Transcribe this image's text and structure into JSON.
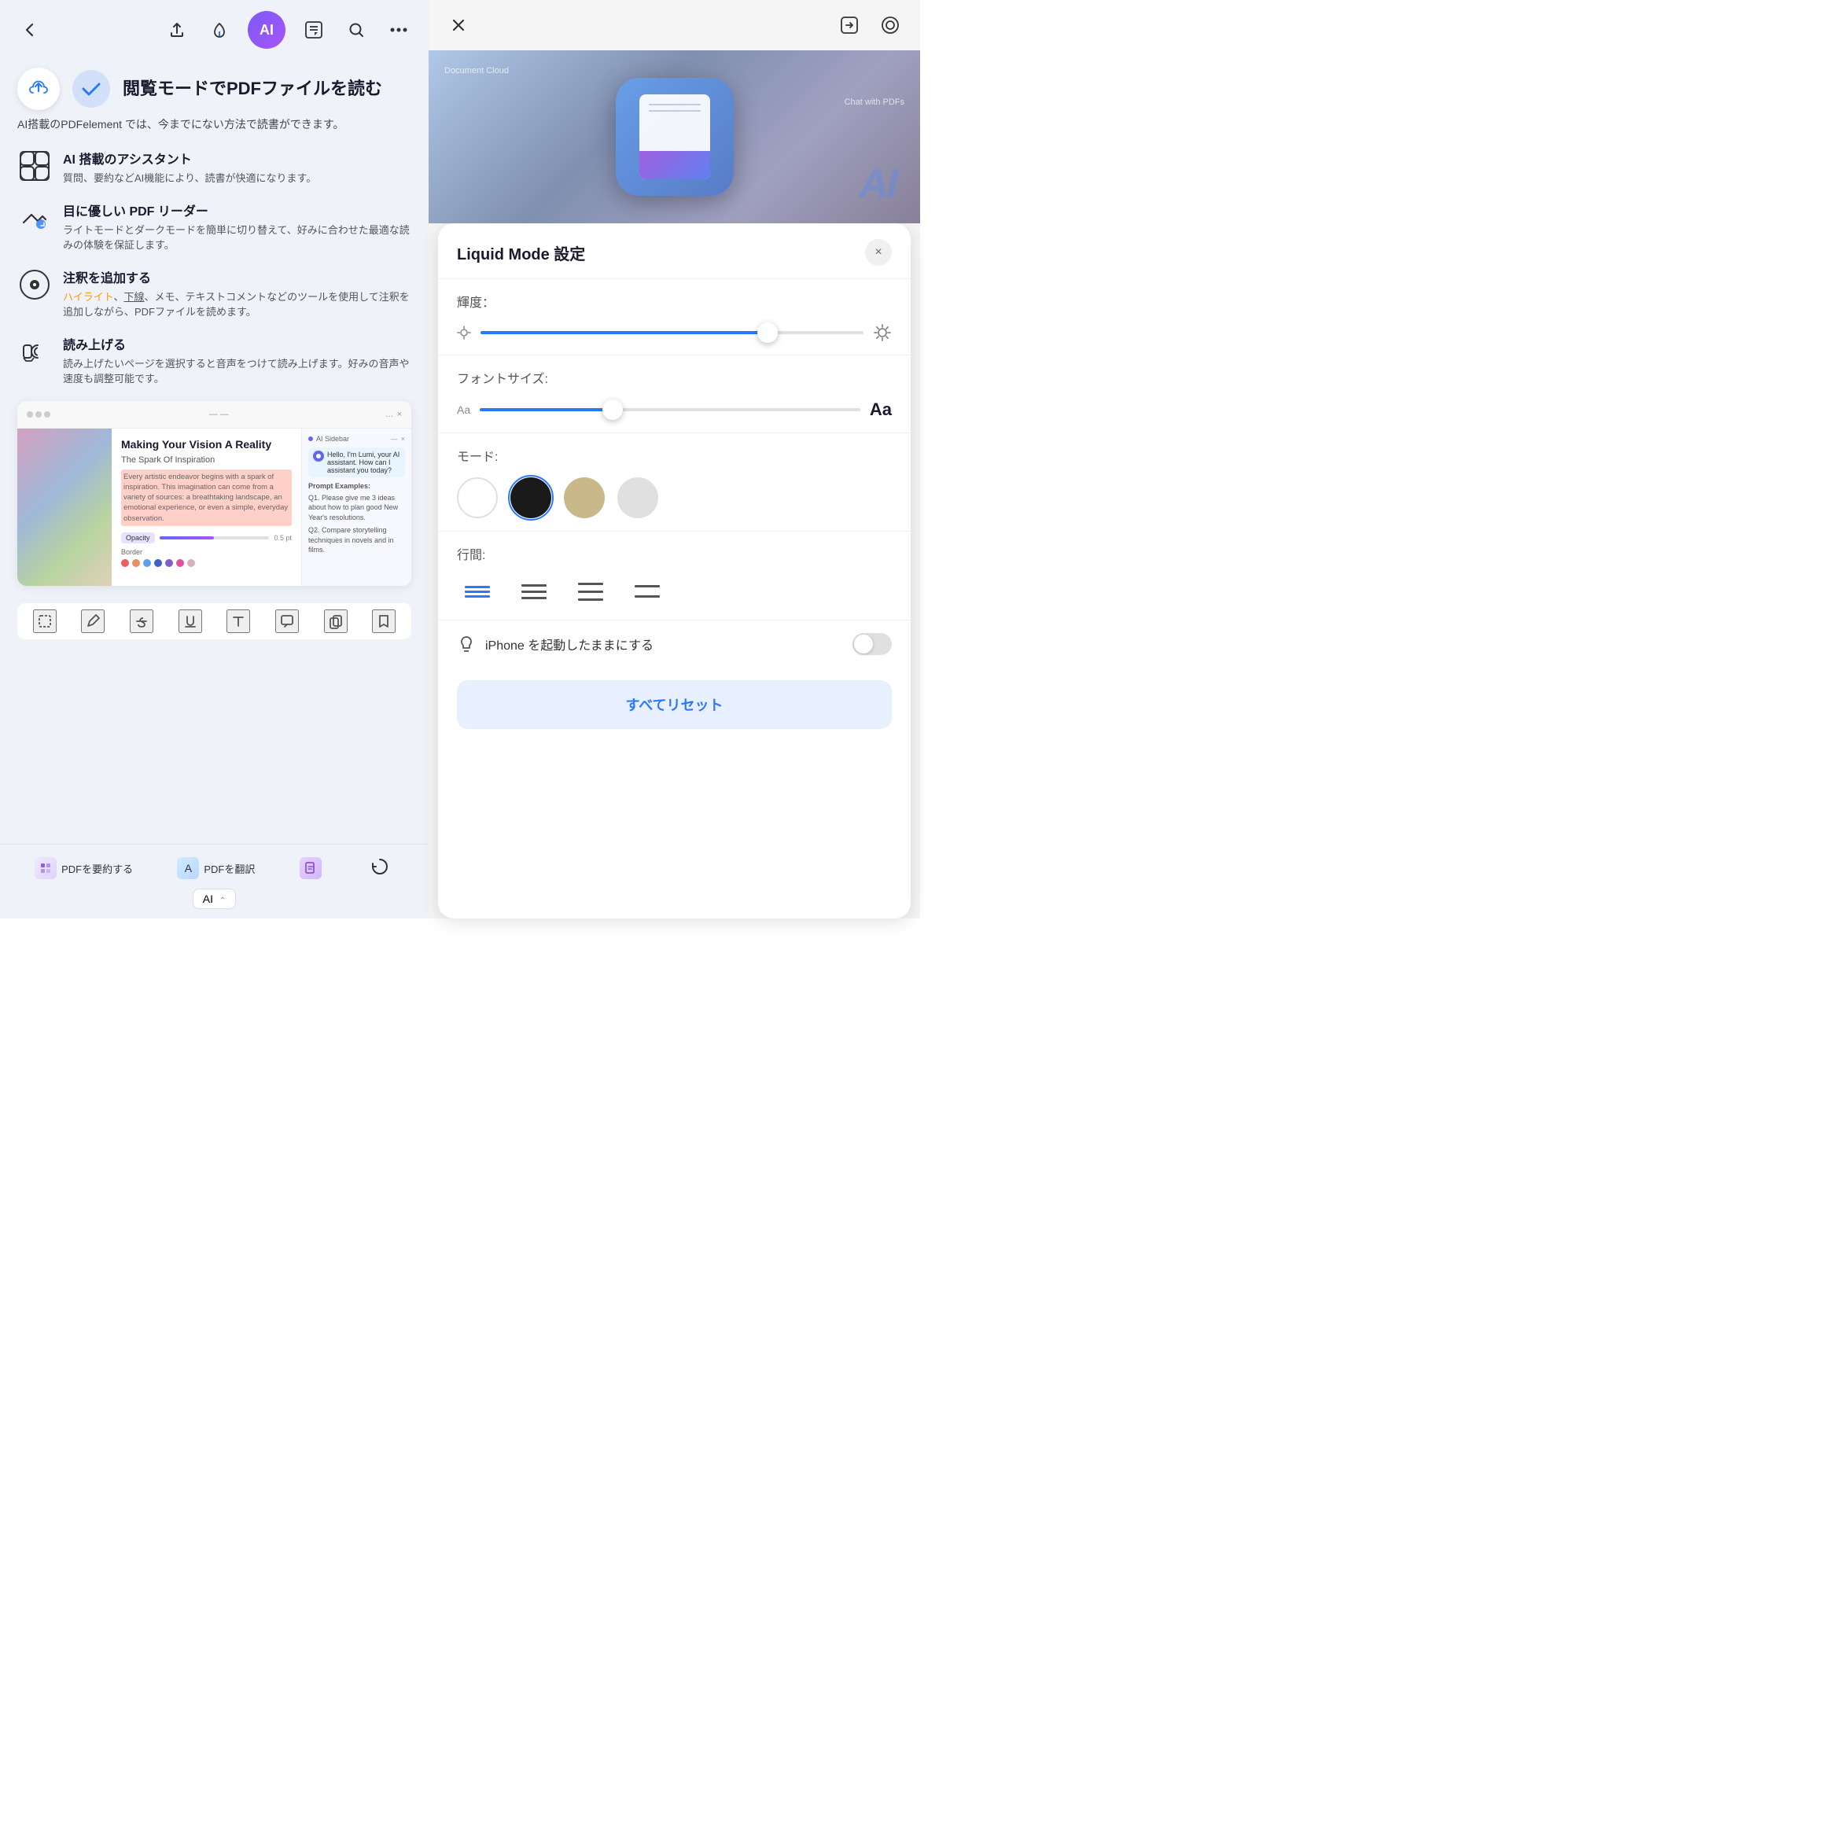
{
  "left": {
    "hero_title": "閲覧モードでPDFファイルを読む",
    "hero_subtitle": "AI搭載のPDFelement では、今までにない方法で読書ができます。",
    "features": [
      {
        "id": "ai-assistant",
        "title": "AI 搭載のアシスタント",
        "desc": "質問、要約などAI機能により、読書が快適になります。"
      },
      {
        "id": "eye-friendly",
        "title": "目に優しい PDF リーダー",
        "desc": "ライトモードとダークモードを簡単に切り替えて、好みに合わせた最適な読みの体験を保証します。"
      },
      {
        "id": "annotation",
        "title": "注釈を追加する",
        "desc_parts": [
          "ハイライト",
          "、",
          "下線",
          "、メモ、テキストコメントなどのツールを使用して注釈を追加しながら、PDFファイルを読めます。"
        ]
      },
      {
        "id": "read-aloud",
        "title": "読み上げる",
        "desc": "読み上げたいページを選択すると音声をつけて読み上げます。好みの音声や速度も調整可能です。"
      }
    ],
    "preview": {
      "title": "Making Your Vision A Reality",
      "subtitle": "The Spark Of Inspiration",
      "body": "Every artistic endeavor begins with a spark of inspiration. This imagination can come from a variety of sources: a breathtaking landscape, an emotional experience, or even a simple, everyday observation.",
      "ai_header": "AI Sidebar",
      "ai_bubble": "Hello, I'm Lumi, your AI assistant. How can I assistant you today?",
      "prompt_label": "Prompt Examples:",
      "prompt1": "Q1. Please give me 3 ideas about how to plan good New Year's resolutions.",
      "prompt2": "Q2. Compare storytelling techniques in novels and in films."
    },
    "bottom": {
      "summarize_label": "PDFを要約する",
      "translate_label": "PDFを翻訳",
      "ai_btn": "AI"
    }
  },
  "right": {
    "modal_title": "Liquid Mode 設定",
    "close_label": "×",
    "brightness_label": "輝度：",
    "brightness_value": 75,
    "font_size_label": "フォントサイズ:",
    "font_size_value": 35,
    "mode_label": "モード:",
    "modes": [
      "white",
      "black",
      "sepia",
      "gray"
    ],
    "selected_mode": 1,
    "spacing_label": "行間:",
    "spacings": [
      2,
      3,
      4,
      5
    ],
    "selected_spacing": 0,
    "keep_awake_label": "iPhone を起動したままにする",
    "reset_label": "すべてリセット",
    "screenshot_labels": {
      "document_cloud": "Document Cloud",
      "chat_pdfs": "Chat with PDFs",
      "ai": "AI"
    }
  }
}
